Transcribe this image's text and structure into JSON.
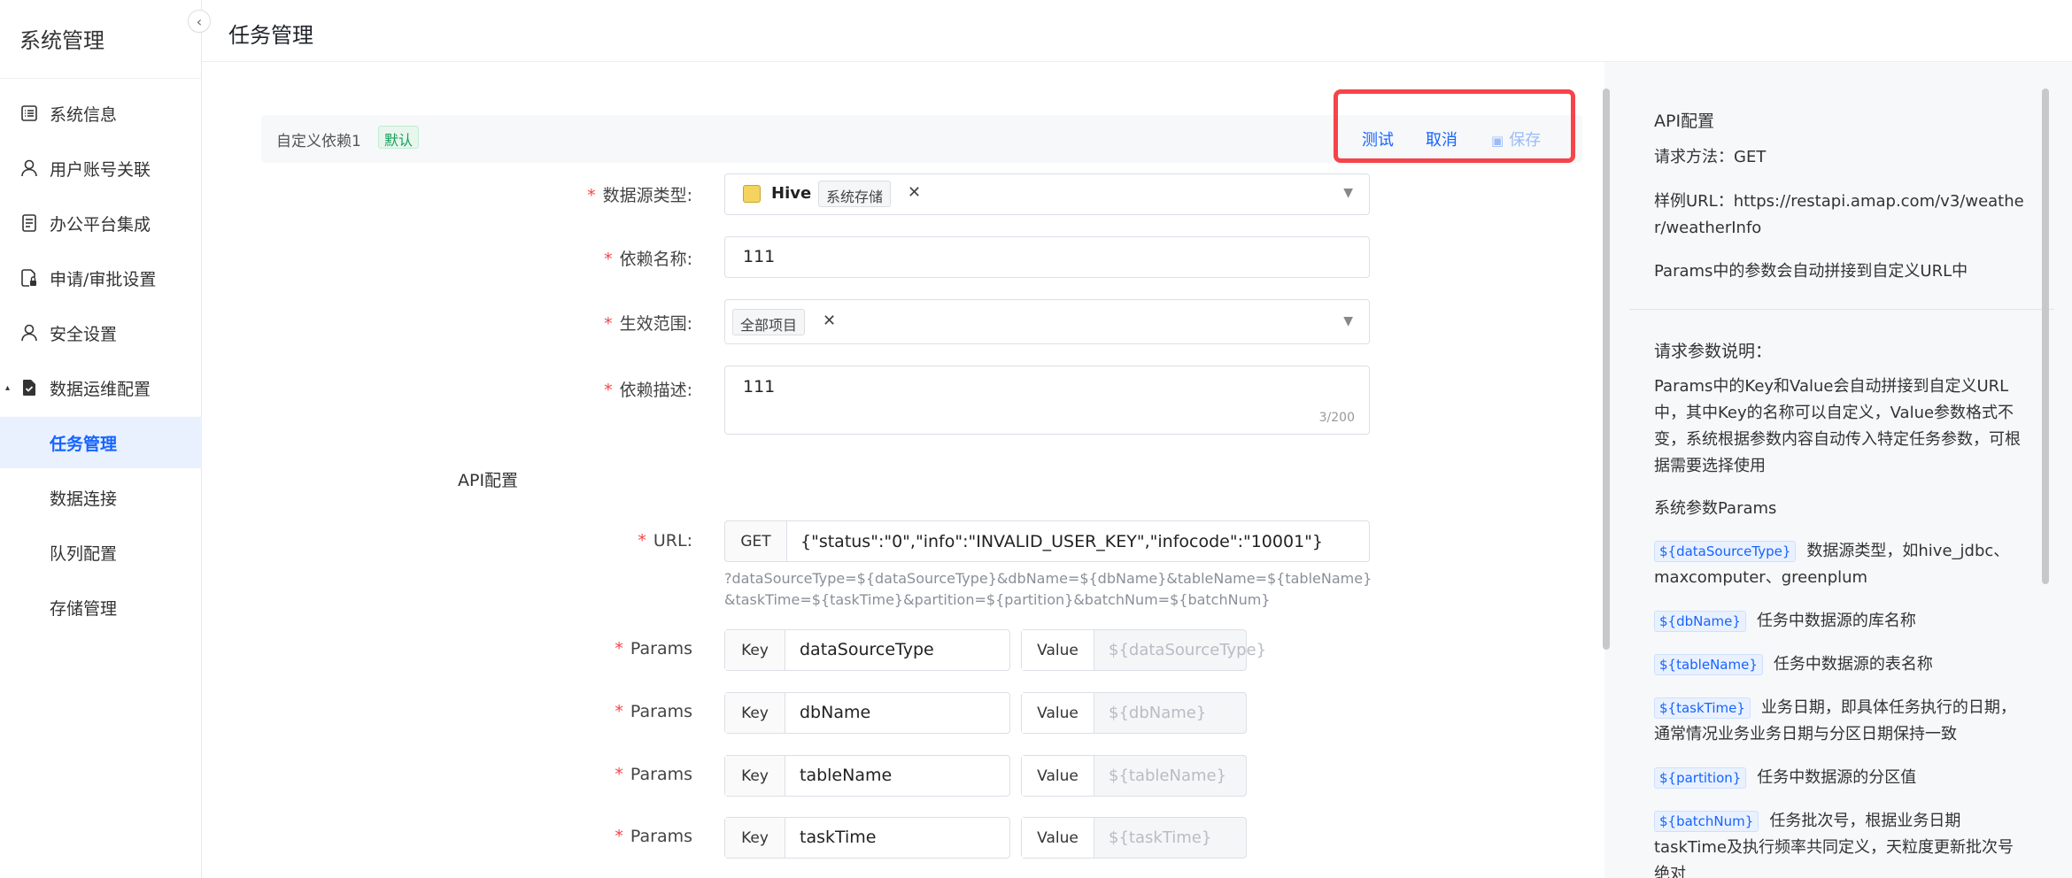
{
  "sidebar": {
    "title": "系统管理",
    "items": [
      {
        "label": "系统信息",
        "icon": "list-icon"
      },
      {
        "label": "用户账号关联",
        "icon": "user-icon"
      },
      {
        "label": "办公平台集成",
        "icon": "document-icon"
      },
      {
        "label": "申请/审批设置",
        "icon": "file-lock-icon"
      },
      {
        "label": "安全设置",
        "icon": "user-icon"
      },
      {
        "label": "数据运维配置",
        "icon": "file-check-icon"
      }
    ],
    "sub_items": [
      "任务管理",
      "数据连接",
      "队列配置",
      "存储管理"
    ],
    "active": "任务管理"
  },
  "header": {
    "title": "任务管理"
  },
  "panel": {
    "dep_title": "自定义依赖1",
    "default_badge": "默认",
    "actions": {
      "test": "测试",
      "cancel": "取消",
      "save": "保存"
    }
  },
  "form": {
    "datasource_type": {
      "label": "数据源类型:",
      "tag": "Hive",
      "tag_sub": "系统存储"
    },
    "dep_name": {
      "label": "依赖名称:",
      "value": "111"
    },
    "scope": {
      "label": "生效范围:",
      "tag": "全部项目"
    },
    "dep_desc": {
      "label": "依赖描述:",
      "value": "111",
      "counter": "3/200"
    },
    "api_section": "API配置",
    "url": {
      "label": "URL:",
      "method": "GET",
      "value": "{\"status\":\"0\",\"info\":\"INVALID_USER_KEY\",\"infocode\":\"10001\"}",
      "hint": "?dataSourceType=${dataSourceType}&dbName=${dbName}&tableName=${tableName}&taskTime=${taskTime}&partition=${partition}&batchNum=${batchNum}"
    },
    "params_label": "Params",
    "key_label": "Key",
    "value_label": "Value",
    "params": [
      {
        "key": "dataSourceType",
        "value_placeholder": "${dataSourceType}"
      },
      {
        "key": "dbName",
        "value_placeholder": "${dbName}"
      },
      {
        "key": "tableName",
        "value_placeholder": "${tableName}"
      },
      {
        "key": "taskTime",
        "value_placeholder": "${taskTime}"
      }
    ]
  },
  "help": {
    "api_title": "API配置",
    "method_line": "请求方法：GET",
    "sample_url": "样例URL：https://restapi.amap.com/v3/weather/weatherInfo",
    "auto_concat": "Params中的参数会自动拼接到自定义URL中",
    "params_title": "请求参数说明：",
    "params_desc": "Params中的Key和Value会自动拼接到自定义URL中，其中Key的名称可以自定义，Value参数格式不变，系统根据参数内容自动传入特定任务参数，可根据需要选择使用",
    "sys_params_title": "系统参数Params",
    "vars": [
      {
        "name": "${dataSourceType}",
        "desc": "数据源类型，如hive_jdbc、maxcomputer、greenplum"
      },
      {
        "name": "${dbName}",
        "desc": "任务中数据源的库名称"
      },
      {
        "name": "${tableName}",
        "desc": "任务中数据源的表名称"
      },
      {
        "name": "${taskTime}",
        "desc": "业务日期，即具体任务执行的日期，通常情况业务业务日期与分区日期保持一致"
      },
      {
        "name": "${partition}",
        "desc": "任务中数据源的分区值"
      },
      {
        "name": "${batchNum}",
        "desc": "任务批次号，根据业务日期taskTime及执行频率共同定义，天粒度更新批次号绝对"
      }
    ]
  }
}
